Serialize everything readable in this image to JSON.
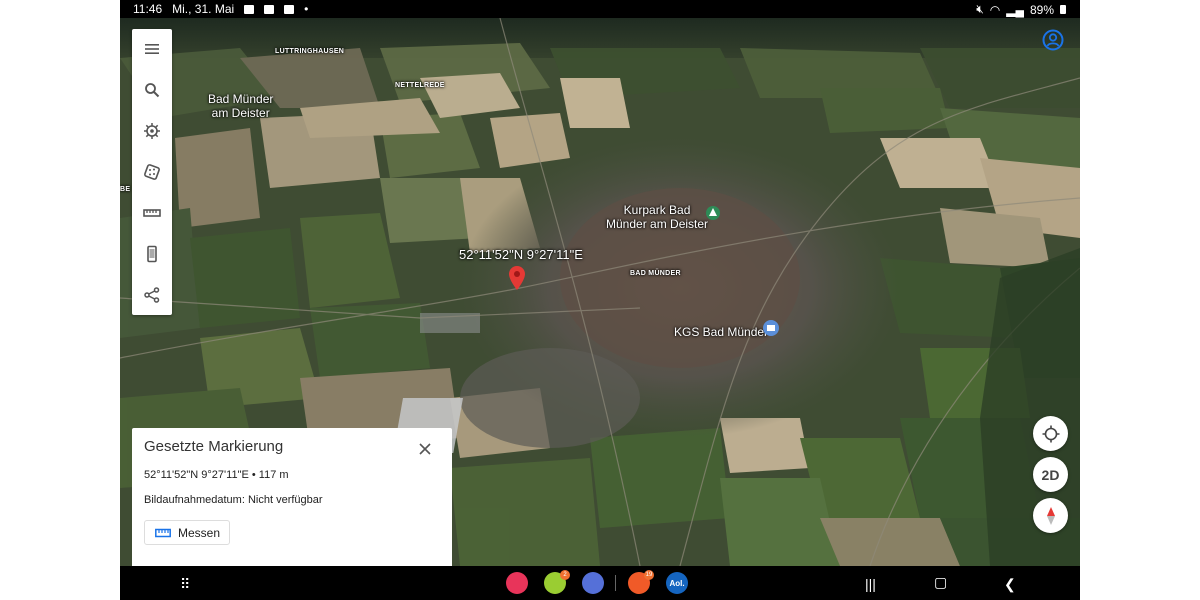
{
  "statusbar": {
    "time": "11:46",
    "date": "Mi., 31. Mai",
    "battery": "89%"
  },
  "map": {
    "labels": {
      "luttringhausen": "LUTTRINGHAUSEN",
      "nettelrede": "NETTELREDE",
      "bad_muender_deister_line1": "Bad Münder",
      "bad_muender_deister_line2": "am Deister",
      "kurpark_line1": "Kurpark Bad",
      "kurpark_line2": "Münder am Deister",
      "bad_muender_town": "BAD MÜNDER",
      "kgs": "KGS Bad Münder",
      "edge_fragment": "BE",
      "pin_coords": "52°11'52\"N 9°27'11\"E"
    }
  },
  "toolbar": {
    "icons": [
      "menu-icon",
      "search-icon",
      "voyager-icon",
      "dice-icon",
      "ruler-icon",
      "phone-icon",
      "share-icon"
    ]
  },
  "controls": {
    "mode_label": "2D"
  },
  "panel": {
    "title": "Gesetzte Markierung",
    "coords": "52°11'52\"N 9°27'11\"E • 117 m",
    "date_label": "Bildaufnahmedatum:",
    "date_value": "Nicht verfügbar",
    "measure_label": "Messen"
  },
  "navbar": {
    "badges": {
      "app2": "2",
      "app4": "19"
    },
    "aol_label": "Aol."
  },
  "colors": {
    "accent": "#1a73e8",
    "pin": "#e53935",
    "badge": "#f07030"
  }
}
